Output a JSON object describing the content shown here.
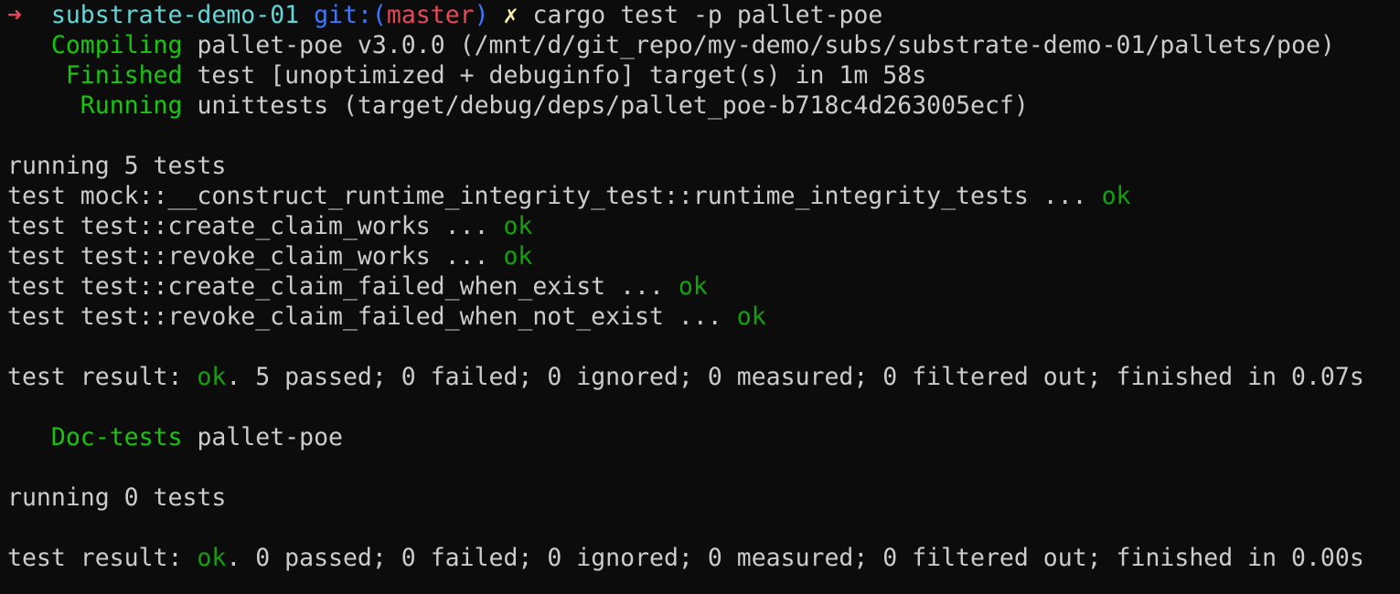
{
  "prompt": {
    "arrow": "➜",
    "directory": "substrate-demo-01",
    "git_label": "git:(",
    "branch": "master",
    "git_close": ")",
    "dirty_mark": "✗",
    "command": "cargo test -p pallet-poe"
  },
  "build": [
    {
      "indent": "   ",
      "status": "Compiling",
      "message": "pallet-poe v3.0.0 (/mnt/d/git_repo/my-demo/subs/substrate-demo-01/pallets/poe)"
    },
    {
      "indent": "    ",
      "status": "Finished",
      "message": "test [unoptimized + debuginfo] target(s) in 1m 58s"
    },
    {
      "indent": "     ",
      "status": "Running",
      "message": "unittests (target/debug/deps/pallet_poe-b718c4d263005ecf)"
    }
  ],
  "unit_tests": {
    "running": "running 5 tests",
    "tests": [
      {
        "name": "test mock::__construct_runtime_integrity_test::runtime_integrity_tests ...",
        "result": "ok"
      },
      {
        "name": "test test::create_claim_works ...",
        "result": "ok"
      },
      {
        "name": "test test::revoke_claim_works ...",
        "result": "ok"
      },
      {
        "name": "test test::create_claim_failed_when_exist ...",
        "result": "ok"
      },
      {
        "name": "test test::revoke_claim_failed_when_not_exist ...",
        "result": "ok"
      }
    ],
    "result_prefix": "test result: ",
    "result_status": "ok",
    "result_suffix": ". 5 passed; 0 failed; 0 ignored; 0 measured; 0 filtered out; finished in 0.07s"
  },
  "doc_tests": {
    "indent": "   ",
    "label": "Doc-tests",
    "package": "pallet-poe",
    "running": "running 0 tests",
    "result_prefix": "test result: ",
    "result_status": "ok",
    "result_suffix": ". 0 passed; 0 failed; 0 ignored; 0 measured; 0 filtered out; finished in 0.00s"
  },
  "colors": {
    "background": "#0c0c0c",
    "foreground": "#cccccc",
    "arrow": "#e74856",
    "cyan": "#61d6d6",
    "blue": "#3b78ff",
    "red": "#e74856",
    "yellow": "#f9f1a5",
    "green": "#16c60c",
    "ok": "#13a10e"
  }
}
